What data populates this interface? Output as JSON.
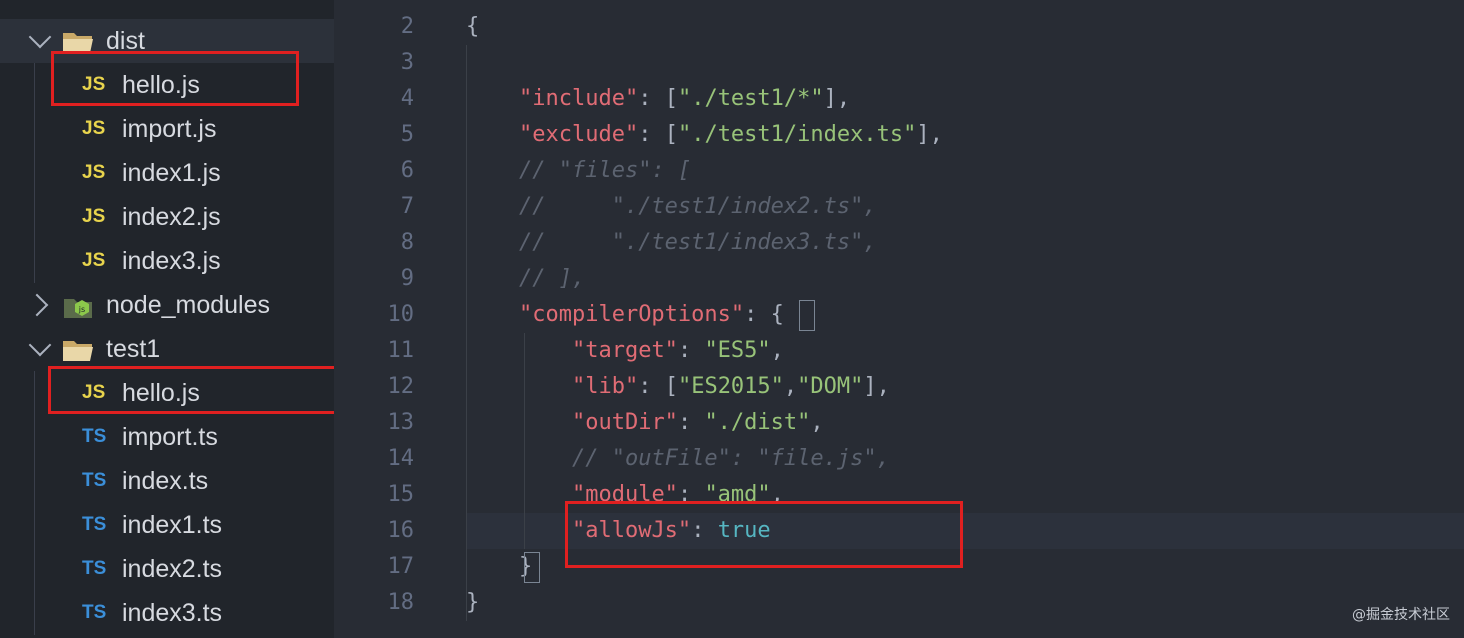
{
  "explorer": {
    "items": [
      {
        "type": "folder",
        "open": true,
        "name": "dist",
        "badge": ""
      },
      {
        "type": "file",
        "badge": "JS",
        "name": "hello.js"
      },
      {
        "type": "file",
        "badge": "JS",
        "name": "import.js"
      },
      {
        "type": "file",
        "badge": "JS",
        "name": "index1.js"
      },
      {
        "type": "file",
        "badge": "JS",
        "name": "index2.js"
      },
      {
        "type": "file",
        "badge": "JS",
        "name": "index3.js"
      },
      {
        "type": "folder",
        "open": false,
        "name": "node_modules",
        "badge": ""
      },
      {
        "type": "folder",
        "open": true,
        "name": "test1",
        "badge": ""
      },
      {
        "type": "file",
        "badge": "JS",
        "name": "hello.js"
      },
      {
        "type": "file",
        "badge": "TS",
        "name": "import.ts"
      },
      {
        "type": "file",
        "badge": "TS",
        "name": "index.ts"
      },
      {
        "type": "file",
        "badge": "TS",
        "name": "index1.ts"
      },
      {
        "type": "file",
        "badge": "TS",
        "name": "index2.ts"
      },
      {
        "type": "file",
        "badge": "TS",
        "name": "index3.ts"
      }
    ]
  },
  "editor": {
    "lines": [
      {
        "n": "2",
        "parts": [
          {
            "t": "{",
            "c": "p"
          }
        ]
      },
      {
        "n": "3",
        "parts": []
      },
      {
        "n": "4",
        "parts": [
          {
            "t": "    "
          },
          {
            "t": "\"include\"",
            "c": "k"
          },
          {
            "t": ": [",
            "c": "p"
          },
          {
            "t": "\"./test1/*\"",
            "c": "s"
          },
          {
            "t": "],",
            "c": "p"
          }
        ]
      },
      {
        "n": "5",
        "parts": [
          {
            "t": "    "
          },
          {
            "t": "\"exclude\"",
            "c": "k"
          },
          {
            "t": ": [",
            "c": "p"
          },
          {
            "t": "\"./test1/index.ts\"",
            "c": "s"
          },
          {
            "t": "],",
            "c": "p"
          }
        ]
      },
      {
        "n": "6",
        "parts": [
          {
            "t": "    "
          },
          {
            "t": "// \"files\": [",
            "c": "c"
          }
        ]
      },
      {
        "n": "7",
        "parts": [
          {
            "t": "    "
          },
          {
            "t": "//     \"./test1/index2.ts\",",
            "c": "c"
          }
        ]
      },
      {
        "n": "8",
        "parts": [
          {
            "t": "    "
          },
          {
            "t": "//     \"./test1/index3.ts\",",
            "c": "c"
          }
        ]
      },
      {
        "n": "9",
        "parts": [
          {
            "t": "    "
          },
          {
            "t": "// ],",
            "c": "c"
          }
        ]
      },
      {
        "n": "10",
        "parts": [
          {
            "t": "    "
          },
          {
            "t": "\"compilerOptions\"",
            "c": "k"
          },
          {
            "t": ": ",
            "c": "p"
          },
          {
            "t": "{",
            "c": "p"
          }
        ]
      },
      {
        "n": "11",
        "parts": [
          {
            "t": "        "
          },
          {
            "t": "\"target\"",
            "c": "k"
          },
          {
            "t": ": ",
            "c": "p"
          },
          {
            "t": "\"ES5\"",
            "c": "s"
          },
          {
            "t": ",",
            "c": "p"
          }
        ]
      },
      {
        "n": "12",
        "parts": [
          {
            "t": "        "
          },
          {
            "t": "\"lib\"",
            "c": "k"
          },
          {
            "t": ": [",
            "c": "p"
          },
          {
            "t": "\"ES2015\"",
            "c": "s"
          },
          {
            "t": ",",
            "c": "p"
          },
          {
            "t": "\"DOM\"",
            "c": "s"
          },
          {
            "t": "],",
            "c": "p"
          }
        ]
      },
      {
        "n": "13",
        "parts": [
          {
            "t": "        "
          },
          {
            "t": "\"outDir\"",
            "c": "k"
          },
          {
            "t": ": ",
            "c": "p"
          },
          {
            "t": "\"./dist\"",
            "c": "s"
          },
          {
            "t": ",",
            "c": "p"
          }
        ]
      },
      {
        "n": "14",
        "parts": [
          {
            "t": "        "
          },
          {
            "t": "// \"outFile\": \"file.js\",",
            "c": "c"
          }
        ]
      },
      {
        "n": "15",
        "parts": [
          {
            "t": "        "
          },
          {
            "t": "\"module\"",
            "c": "k"
          },
          {
            "t": ": ",
            "c": "p"
          },
          {
            "t": "\"amd\"",
            "c": "s"
          },
          {
            "t": ",",
            "c": "p"
          }
        ]
      },
      {
        "n": "16",
        "parts": [
          {
            "t": "        "
          },
          {
            "t": "\"allowJs\"",
            "c": "k"
          },
          {
            "t": ": ",
            "c": "p"
          },
          {
            "t": "true",
            "c": "b"
          }
        ]
      },
      {
        "n": "17",
        "parts": [
          {
            "t": "    "
          },
          {
            "t": "}",
            "c": "p"
          }
        ]
      },
      {
        "n": "18",
        "parts": [
          {
            "t": "}",
            "c": "p"
          }
        ]
      }
    ]
  },
  "watermark": "@掘金技术社区",
  "colors": {
    "accent_red": "#e02020",
    "sidebar_bg": "#21252b",
    "editor_bg": "#282c34"
  }
}
